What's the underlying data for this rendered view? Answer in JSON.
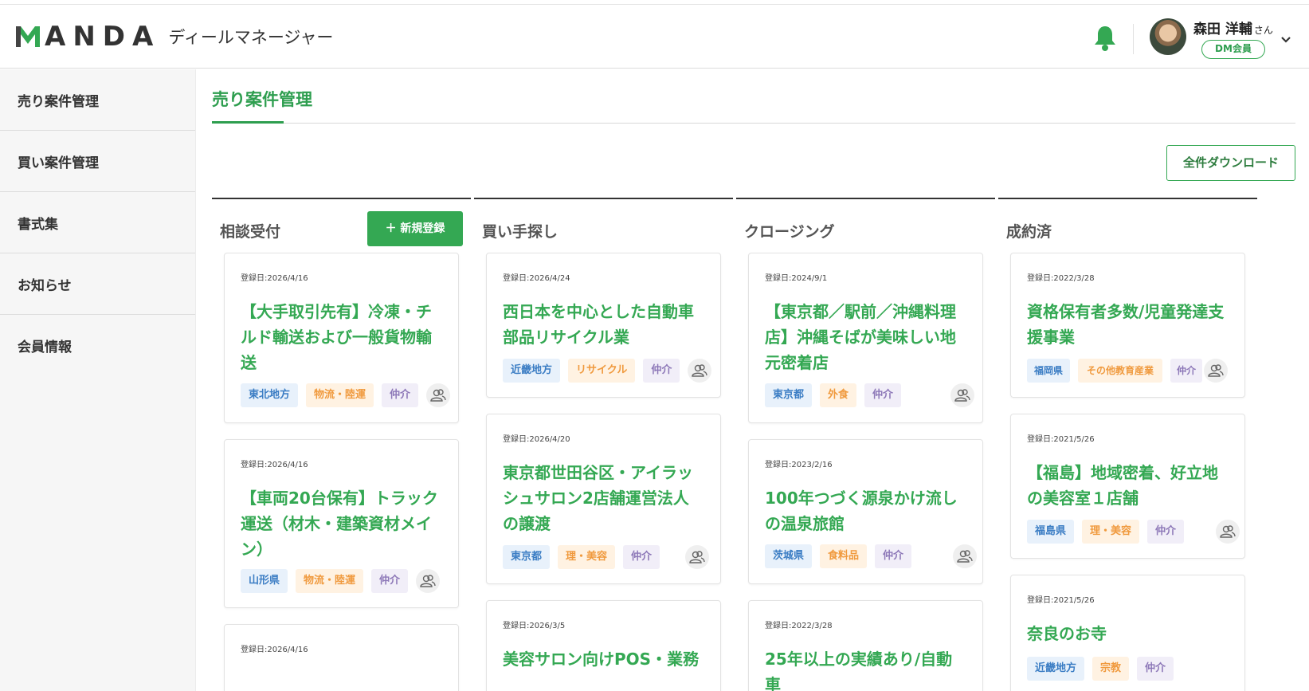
{
  "app": {
    "logo_text": "ANDA",
    "subtitle": "ディールマネージャー"
  },
  "user": {
    "name": "森田 洋輔",
    "honorific": "さん",
    "badge": "DM会員"
  },
  "sidebar": {
    "items": [
      {
        "label": "売り案件管理"
      },
      {
        "label": "買い案件管理"
      },
      {
        "label": "書式集"
      },
      {
        "label": "お知らせ"
      },
      {
        "label": "会員情報"
      }
    ]
  },
  "main": {
    "title": "売り案件管理",
    "download_label": "全件ダウンロード",
    "new_button_label": "＋ 新規登録",
    "columns": [
      {
        "title": "相談受付",
        "cards": [
          {
            "date": "登録日:2026/4/16",
            "title": "【大手取引先有】冷凍・チルド輸送および一般貨物輸送",
            "tags": [
              "東北地方",
              "物流・陸運",
              "仲介"
            ]
          },
          {
            "date": "登録日:2026/4/16",
            "title": "【車両20台保有】トラック運送（材木・建築資材メイン）",
            "tags": [
              "山形県",
              "物流・陸運",
              "仲介"
            ]
          },
          {
            "date": "登録日:2026/4/16",
            "title": "",
            "tags": []
          }
        ]
      },
      {
        "title": "買い手探し",
        "cards": [
          {
            "date": "登録日:2026/4/24",
            "title": "西日本を中心とした自動車部品リサイクル業",
            "tags": [
              "近畿地方",
              "リサイクル",
              "仲介"
            ]
          },
          {
            "date": "登録日:2026/4/20",
            "title": "東京都世田谷区・アイラッシュサロン2店舗運営法人の譲渡",
            "tags": [
              "東京都",
              "理・美容",
              "仲介"
            ]
          },
          {
            "date": "登録日:2026/3/5",
            "title": "美容サロン向けPOS・業務",
            "tags": []
          }
        ]
      },
      {
        "title": "クロージング",
        "cards": [
          {
            "date": "登録日:2024/9/1",
            "title": "【東京都／駅前／沖縄料理店】沖縄そばが美味しい地元密着店",
            "tags": [
              "東京都",
              "外食",
              "仲介"
            ]
          },
          {
            "date": "登録日:2023/2/16",
            "title": "100年つづく源泉かけ流しの温泉旅館",
            "tags": [
              "茨城県",
              "食料品",
              "仲介"
            ]
          },
          {
            "date": "登録日:2022/3/28",
            "title": "25年以上の実績あり/自動車",
            "tags": []
          }
        ]
      },
      {
        "title": "成約済",
        "cards": [
          {
            "date": "登録日:2022/3/28",
            "title": "資格保有者多数/児童発達支援事業",
            "tags": [
              "福岡県",
              "その他教育産業",
              "仲介"
            ]
          },
          {
            "date": "登録日:2021/5/26",
            "title": "【福島】地域密着、好立地の美容室１店舗",
            "tags": [
              "福島県",
              "理・美容",
              "仲介"
            ]
          },
          {
            "date": "登録日:2021/5/26",
            "title": "奈良のお寺",
            "tags": [
              "近畿地方",
              "宗教",
              "仲介"
            ]
          }
        ]
      }
    ]
  }
}
